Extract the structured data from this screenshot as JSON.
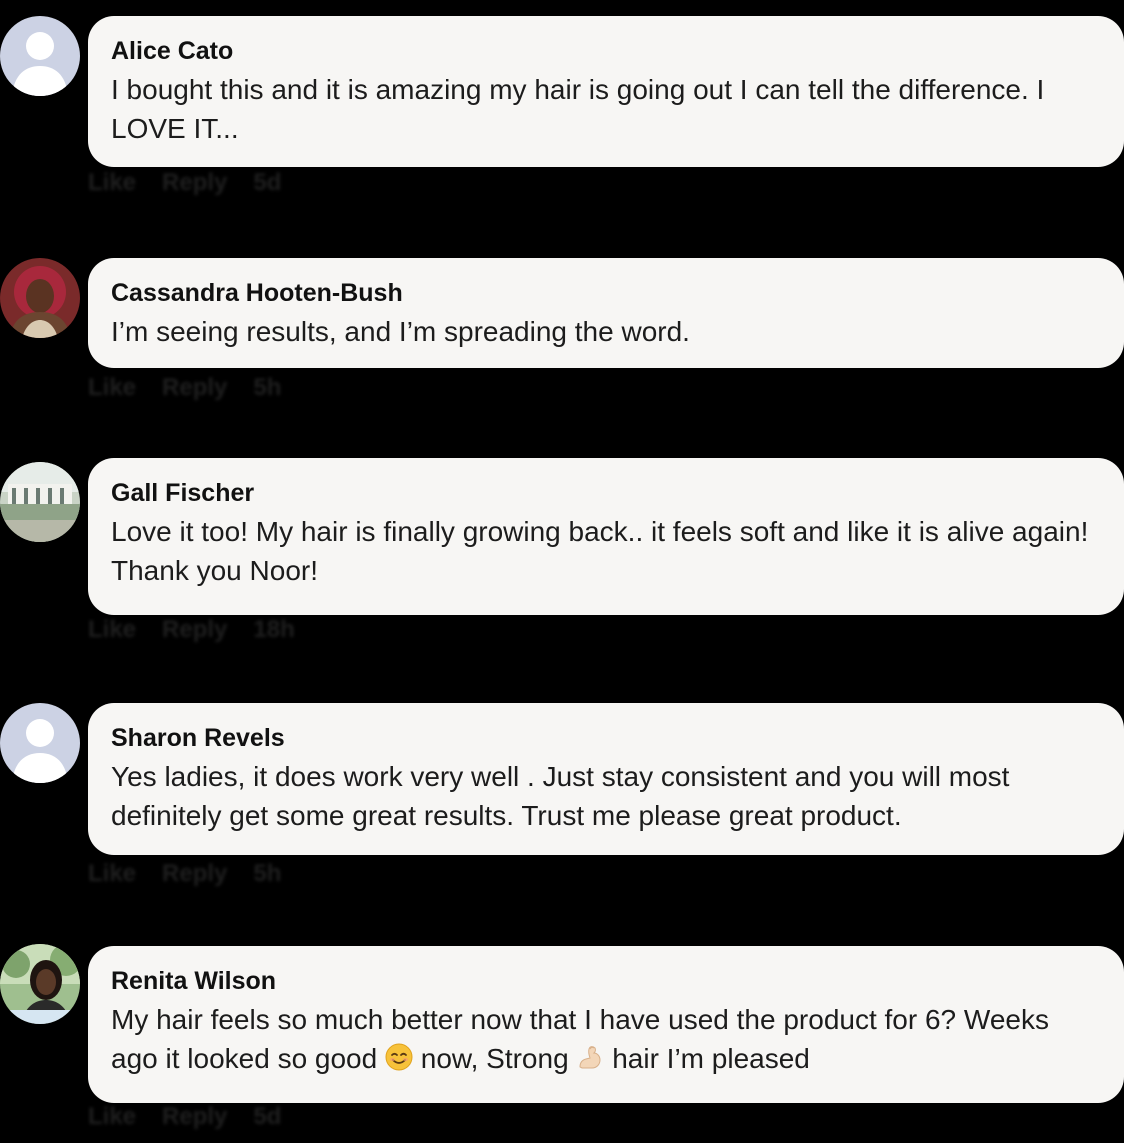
{
  "comments": [
    {
      "author": "Alice Cato",
      "text": "I bought this and it is amazing my hair is going out I can tell the difference. I LOVE IT...",
      "avatar_icon": "default-avatar-icon",
      "actions": {
        "like": "Like",
        "reply": "Reply",
        "time": "5d"
      }
    },
    {
      "author": "Cassandra Hooten-Bush",
      "text": "I’m seeing results, and I’m spreading the word.",
      "avatar_icon": "profile-photo",
      "actions": {
        "like": "Like",
        "reply": "Reply",
        "time": "5h"
      }
    },
    {
      "author": "Gall Fischer",
      "text": "Love it too! My hair is finally growing back.. it feels soft and like it is alive again! Thank you Noor!",
      "avatar_icon": "profile-photo",
      "actions": {
        "like": "Like",
        "reply": "Reply",
        "time": "18h"
      }
    },
    {
      "author": "Sharon Revels",
      "text": "Yes ladies, it does work very well . Just stay consistent and you will most definitely get some great results. Trust me please great product.",
      "avatar_icon": "default-avatar-icon",
      "actions": {
        "like": "Like",
        "reply": "Reply",
        "time": "5h"
      }
    },
    {
      "author": "Renita Wilson",
      "text_before_emoji1": "My hair feels so much better now that I have used the product for 6? Weeks ago it looked so good ",
      "text_middle": " now, Strong ",
      "text_after_emoji2": " hair I’m pleased",
      "emoji1": "smiling-face-emoji",
      "emoji2": "flexed-biceps-emoji",
      "avatar_icon": "profile-photo",
      "actions": {
        "like": "Like",
        "reply": "Reply",
        "time": "5d"
      }
    }
  ],
  "colors": {
    "background": "#000000",
    "bubble": "#f7f6f4",
    "author_text": "#111111",
    "body_text": "#1c1c1c",
    "default_avatar": "#ccd2e4"
  }
}
